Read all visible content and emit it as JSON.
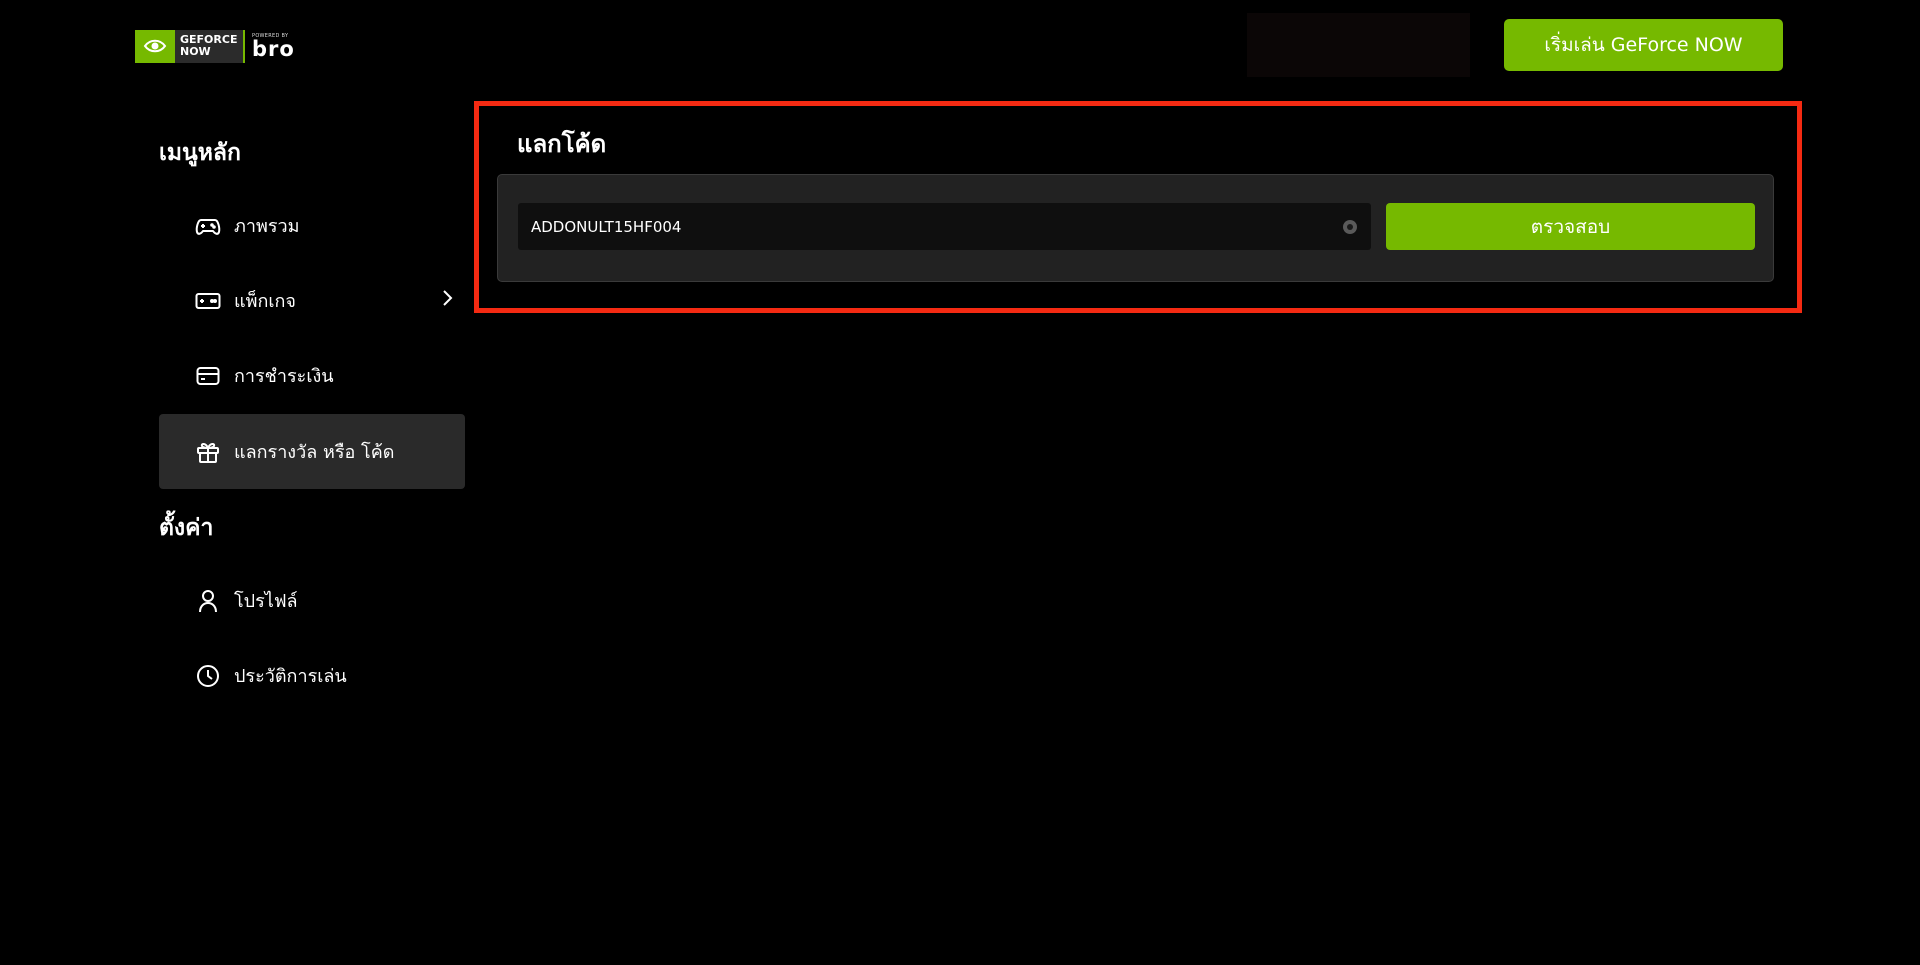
{
  "brand": {
    "logo_text_line1": "GEFORCE",
    "logo_text_line2": "NOW",
    "powered_by": "POWERED BY",
    "partner": "bro",
    "accent_color": "#76b900"
  },
  "header": {
    "start_button_label": "เริ่มเล่น GeForce NOW"
  },
  "sidebar": {
    "main_menu_title": "เมนูหลัก",
    "settings_title": "ตั้งค่า",
    "main_items": [
      {
        "label": "ภาพรวม",
        "icon": "gamepad-icon"
      },
      {
        "label": "แพ็กเกจ",
        "icon": "controller-card-icon"
      },
      {
        "label": "การชำระเงิน",
        "icon": "credit-card-icon"
      },
      {
        "label": "แลกรางวัล หรือ โค้ด",
        "icon": "gift-icon",
        "active": true
      }
    ],
    "settings_items": [
      {
        "label": "โปรไฟล์",
        "icon": "user-icon"
      },
      {
        "label": "ประวัติการเล่น",
        "icon": "clock-icon"
      }
    ]
  },
  "redeem": {
    "title": "แลกโค้ด",
    "code_value": "ADDONULT15HF004",
    "verify_label": "ตรวจสอบ",
    "highlight_color": "#f42a12"
  }
}
